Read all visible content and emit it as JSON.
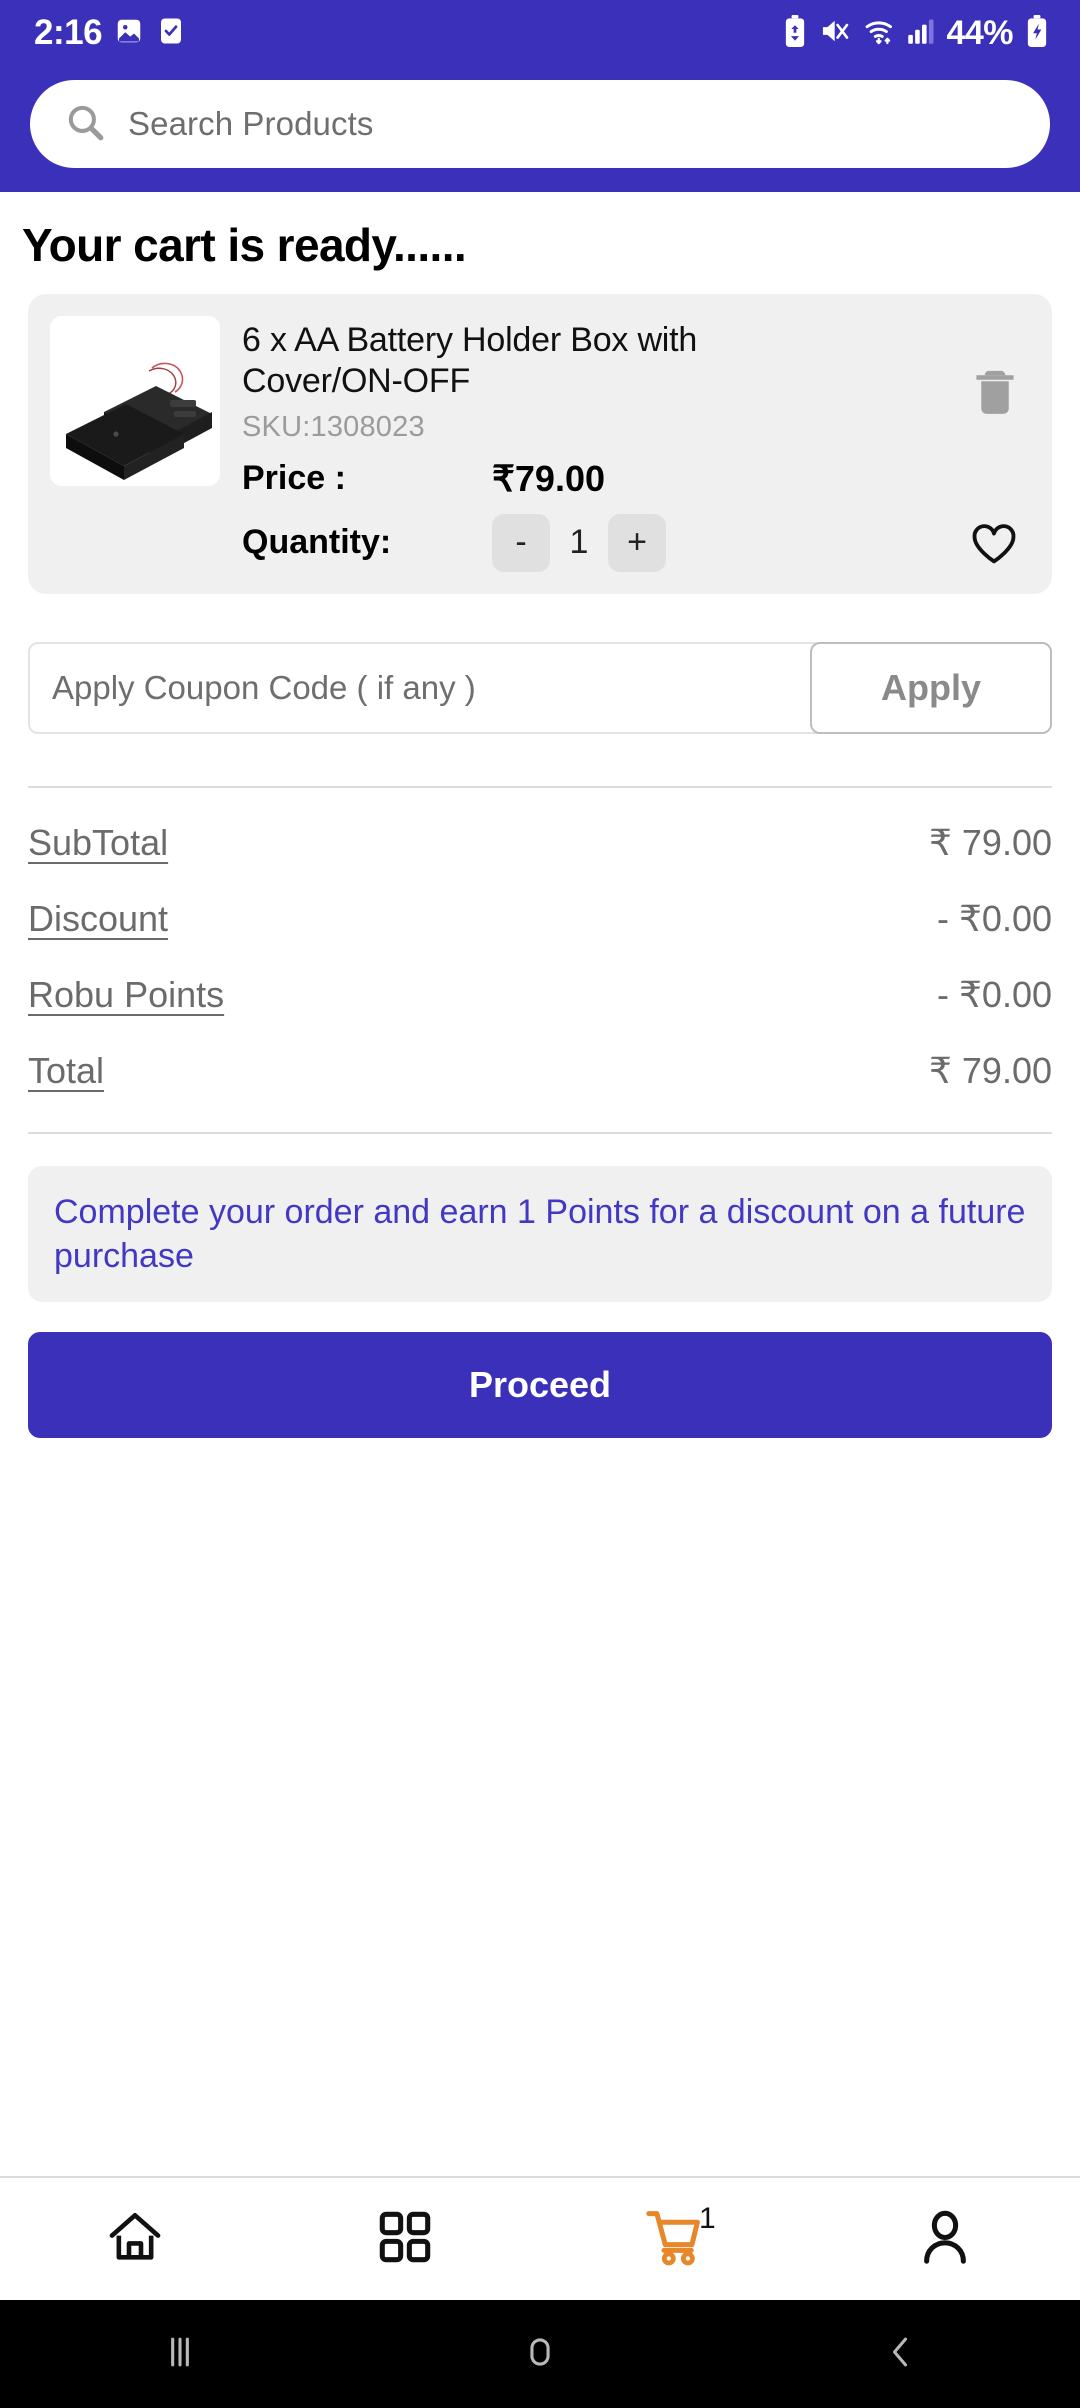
{
  "status_bar": {
    "time": "2:16",
    "battery_percent": "44%",
    "icons": [
      "gallery-icon",
      "tasks-icon",
      "battery-saver-icon",
      "mute-vibrate-icon",
      "wifi-icon",
      "signal-icon",
      "charging-battery-icon"
    ]
  },
  "header": {
    "brand_color": "#3B30B9",
    "search": {
      "placeholder": "Search Products",
      "value": ""
    }
  },
  "page": {
    "title": "Your cart is ready......"
  },
  "cart_item": {
    "title": "6 x AA Battery Holder Box with Cover/ON-OFF",
    "sku": "SKU:1308023",
    "price_label": "Price :",
    "price_value": "₹79.00",
    "quantity_label": "Quantity:",
    "decrement_label": "-",
    "quantity_value": "1",
    "increment_label": "+",
    "delete_icon": "trash-icon",
    "wishlist_icon": "heart-icon"
  },
  "coupon": {
    "placeholder": "Apply Coupon Code ( if any )",
    "value": "",
    "apply_label": "Apply"
  },
  "summary": {
    "rows": [
      {
        "label": "SubTotal",
        "value": "₹ 79.00"
      },
      {
        "label": "Discount",
        "value": "- ₹0.00"
      },
      {
        "label": "Robu Points",
        "value": "- ₹0.00"
      },
      {
        "label": "Total",
        "value": "₹ 79.00"
      }
    ]
  },
  "points_banner": {
    "text": "Complete your order and earn 1 Points for a discount on a future purchase",
    "color": "#4338c4"
  },
  "proceed": {
    "label": "Proceed"
  },
  "bottom_nav": {
    "items": [
      {
        "icon": "home-icon",
        "active": false
      },
      {
        "icon": "categories-icon",
        "active": false
      },
      {
        "icon": "cart-icon",
        "active": true,
        "badge": "1",
        "color": "#E8862A"
      },
      {
        "icon": "account-icon",
        "active": false
      }
    ]
  },
  "android_nav": {
    "items": [
      "recents-icon",
      "home-icon",
      "back-icon"
    ]
  }
}
